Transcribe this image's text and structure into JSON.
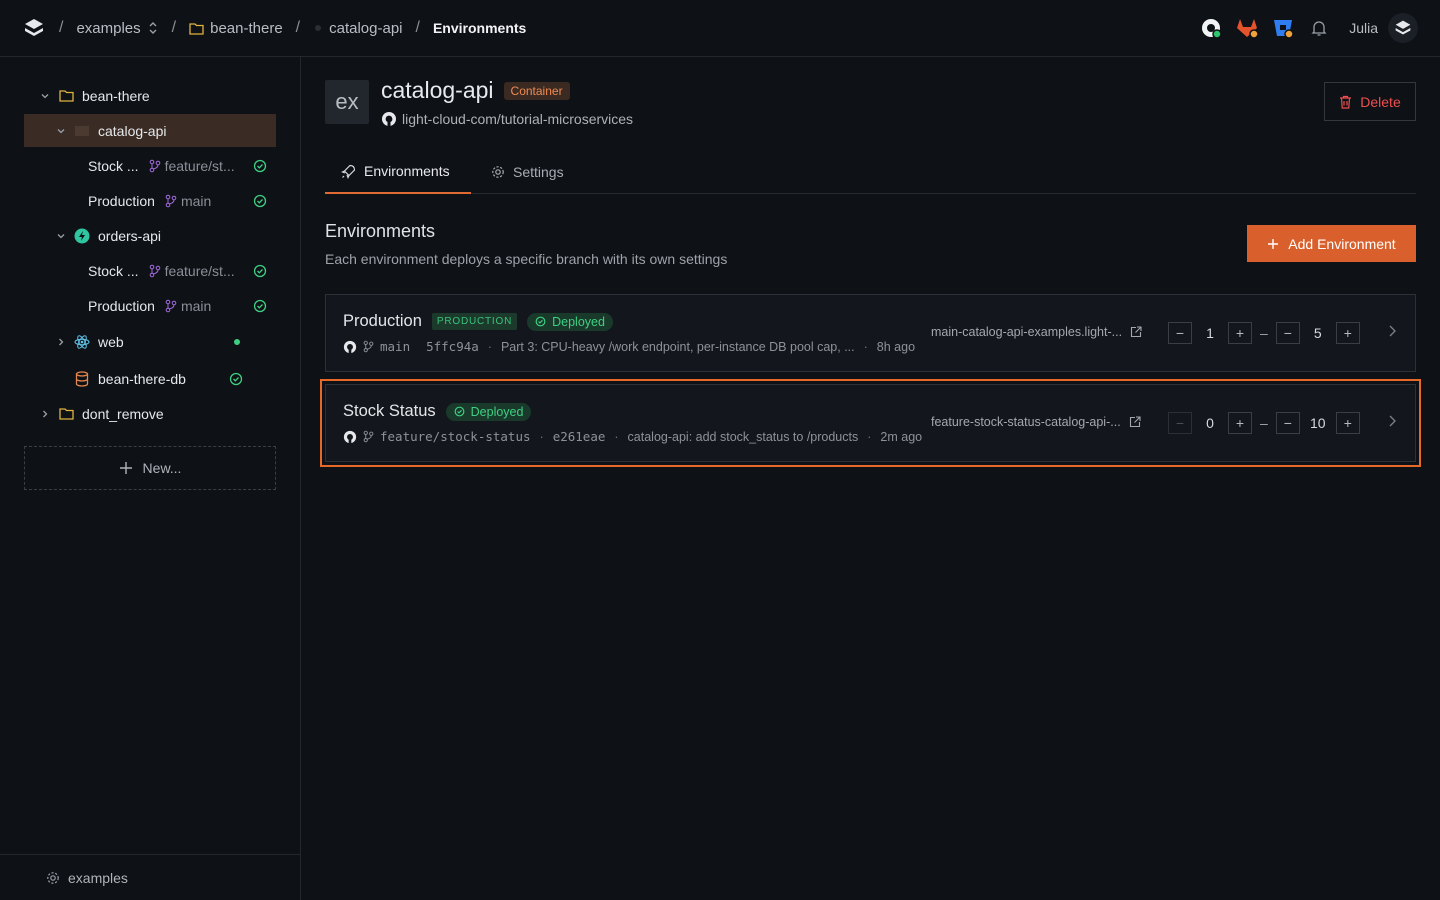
{
  "topbar": {
    "breadcrumbs": {
      "org": "examples",
      "project": "bean-there",
      "service": "catalog-api",
      "page": "Environments"
    },
    "user": "Julia"
  },
  "sidebar": {
    "project": "bean-there",
    "services": [
      {
        "name": "catalog-api",
        "envs": [
          {
            "name": "Stock ...",
            "branch": "feature/st..."
          },
          {
            "name": "Production",
            "branch": "main"
          }
        ]
      },
      {
        "name": "orders-api",
        "envs": [
          {
            "name": "Stock ...",
            "branch": "feature/st..."
          },
          {
            "name": "Production",
            "branch": "main"
          }
        ]
      },
      {
        "name": "web"
      },
      {
        "name": "bean-there-db"
      }
    ],
    "other_project": "dont_remove",
    "new_label": "New...",
    "footer": "examples"
  },
  "service": {
    "icon_text": "ex",
    "name": "catalog-api",
    "type_badge": "Container",
    "repo": "light-cloud-com/tutorial-microservices",
    "delete_label": "Delete"
  },
  "tabs": {
    "environments": "Environments",
    "settings": "Settings"
  },
  "environments_section": {
    "title": "Environments",
    "subtitle": "Each environment deploys a specific branch with its own settings",
    "add_label": "Add Environment"
  },
  "envs": [
    {
      "name": "Production",
      "prod_badge": "PRODUCTION",
      "status": "Deployed",
      "branch": "main",
      "commit": "5ffc94a",
      "message": "Part 3: CPU-heavy /work endpoint, per-instance DB pool cap, ...",
      "time": "8h ago",
      "url": "main-catalog-api-examples.light-...",
      "min": "1",
      "max": "5",
      "dash": "–"
    },
    {
      "name": "Stock Status",
      "status": "Deployed",
      "branch": "feature/stock-status",
      "commit": "e261eae",
      "message": "catalog-api: add stock_status to /products",
      "time": "2m ago",
      "url": "feature-stock-status-catalog-api-...",
      "min": "0",
      "max": "10",
      "dash": "–"
    }
  ],
  "colors": {
    "accent": "#d9602c",
    "deployed": "#3fcf83",
    "danger": "#ef4e4e",
    "background": "#0e1116"
  }
}
